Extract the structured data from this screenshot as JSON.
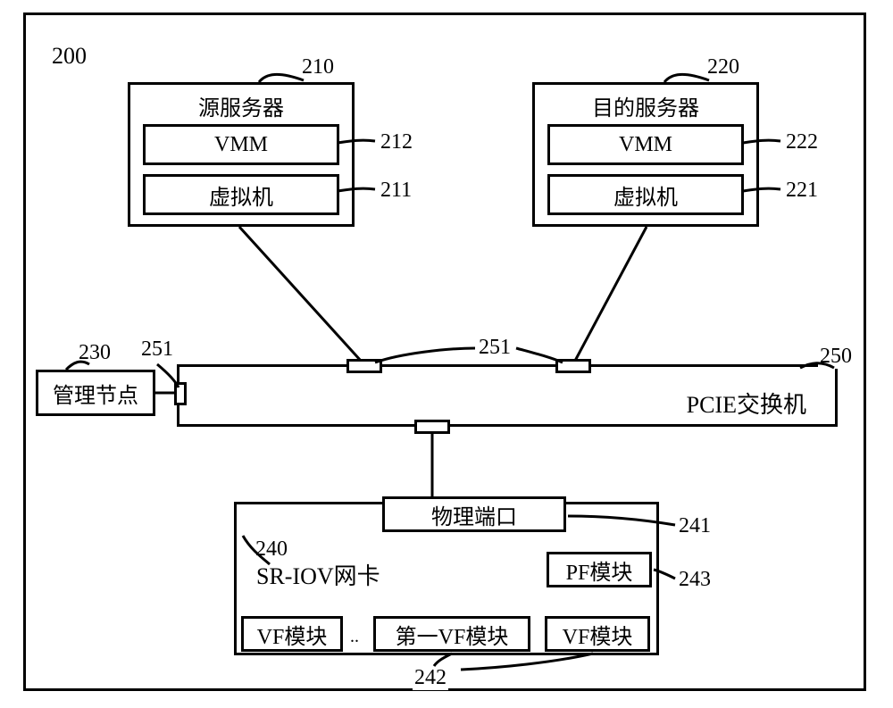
{
  "diagram": {
    "system_ref": "200",
    "source_server": {
      "title": "源服务器",
      "ref": "210",
      "vmm": "VMM",
      "vmm_ref": "212",
      "vm": "虚拟机",
      "vm_ref": "211"
    },
    "dest_server": {
      "title": "目的服务器",
      "ref": "220",
      "vmm": "VMM",
      "vmm_ref": "222",
      "vm": "虚拟机",
      "vm_ref": "221"
    },
    "mgmt_node": {
      "title": "管理节点",
      "ref": "230"
    },
    "pcie_switch": {
      "title": "PCIE交换机",
      "ref": "250",
      "port_ref": "251"
    },
    "nic": {
      "title": "SR-IOV网卡",
      "ref": "240",
      "phys_port": "物理端口",
      "phys_port_ref": "241",
      "pf": "PF模块",
      "pf_ref": "243",
      "vf_left": "VF模块",
      "vf_mid": "第一VF模块",
      "vf_right": "VF模块",
      "vf_ellipsis": "..",
      "vf_ref": "242"
    }
  }
}
